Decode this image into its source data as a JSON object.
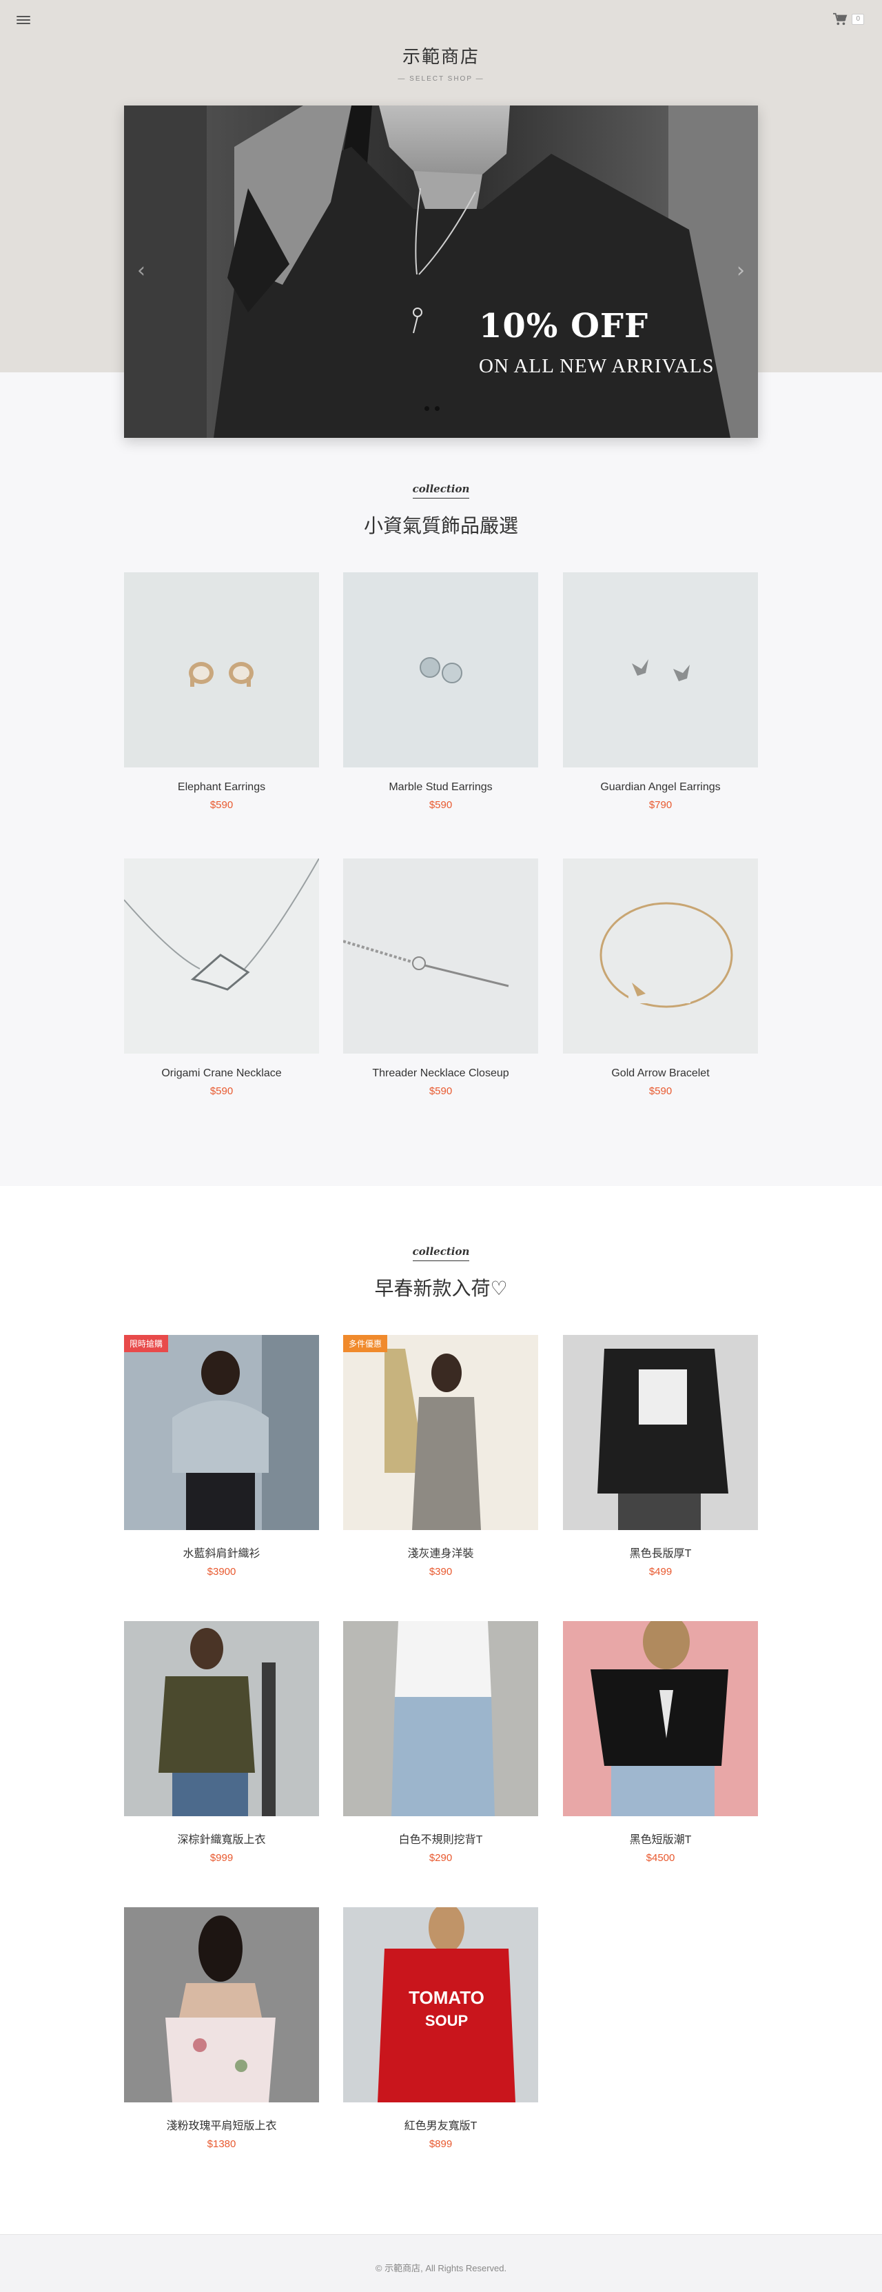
{
  "header": {
    "cart_count": "0",
    "brand_name": "示範商店",
    "brand_sub": "— SELECT SHOP —"
  },
  "hero": {
    "title": "10% OFF",
    "subtitle": "ON ALL NEW ARRIVALS",
    "prev_arrow": "‹",
    "next_arrow": "›"
  },
  "collection1": {
    "tag": "collection",
    "title": "小資氣質飾品嚴選",
    "products": [
      {
        "name": "Elephant Earrings",
        "price": "$590"
      },
      {
        "name": "Marble Stud Earrings",
        "price": "$590"
      },
      {
        "name": "Guardian Angel Earrings",
        "price": "$790"
      },
      {
        "name": "Origami Crane Necklace",
        "price": "$590"
      },
      {
        "name": "Threader Necklace Closeup",
        "price": "$590"
      },
      {
        "name": "Gold Arrow Bracelet",
        "price": "$590"
      }
    ]
  },
  "collection2": {
    "tag": "collection",
    "title": "早春新款入荷♡",
    "products": [
      {
        "name": "水藍斜肩針織衫",
        "price": "$3900",
        "badge": "限時搶購",
        "badge_color": "#e84a4a"
      },
      {
        "name": "淺灰連身洋裝",
        "price": "$390",
        "badge": "多件優惠",
        "badge_color": "#f08a2c"
      },
      {
        "name": "黑色長版厚T",
        "price": "$499"
      },
      {
        "name": "深棕針織寬版上衣",
        "price": "$999"
      },
      {
        "name": "白色不規則挖背T",
        "price": "$290"
      },
      {
        "name": "黑色短版潮T",
        "price": "$4500"
      },
      {
        "name": "淺粉玫瑰平肩短版上衣",
        "price": "$1380"
      },
      {
        "name": "紅色男友寬版T",
        "price": "$899"
      }
    ]
  },
  "footer": {
    "copyright": "© 示範商店, All Rights Reserved."
  },
  "colors": {
    "header_bg": "#e2dfdb",
    "price": "#e8592f",
    "page_bg": "#f7f7f9"
  }
}
